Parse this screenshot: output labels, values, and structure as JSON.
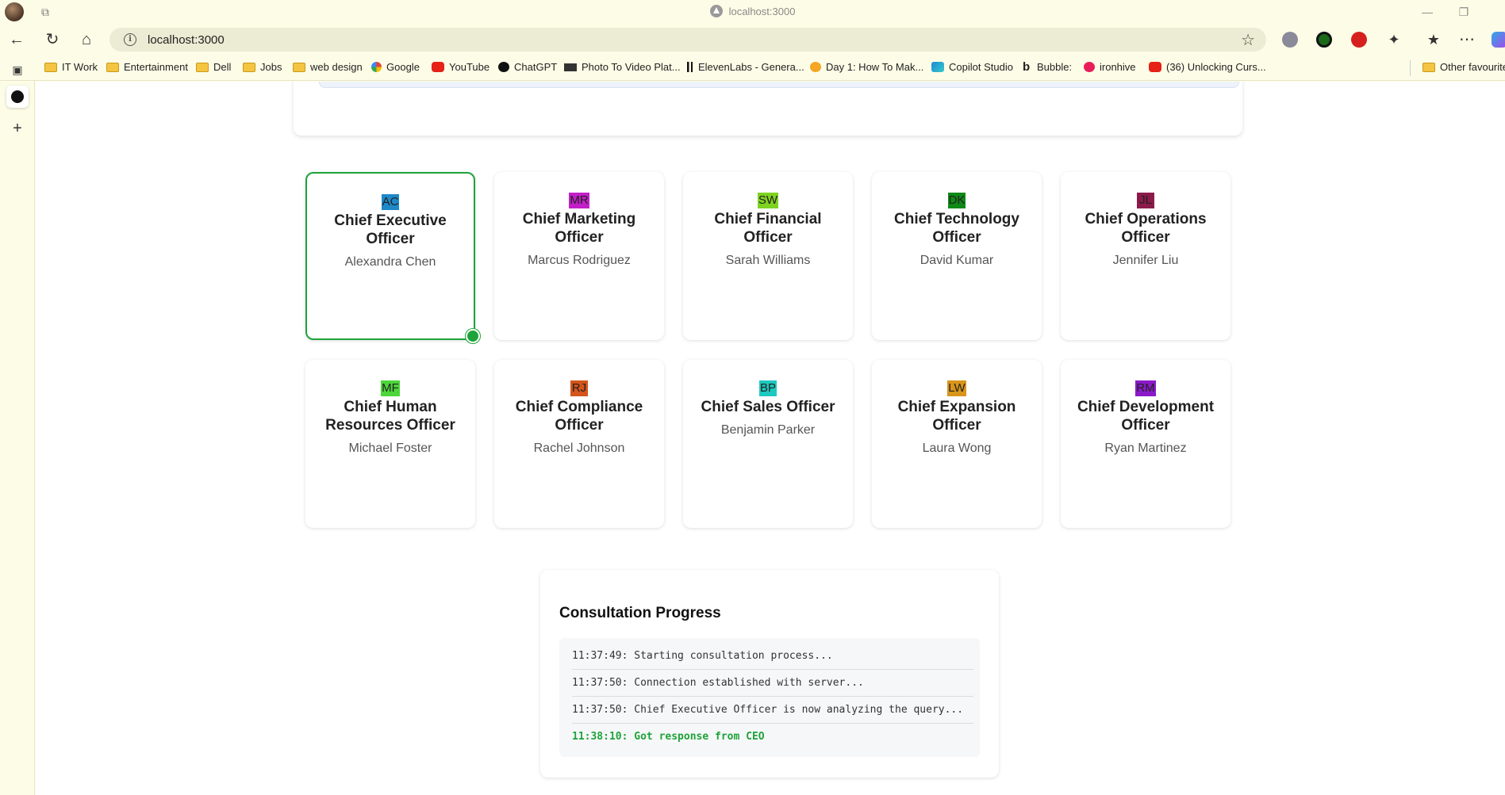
{
  "browser": {
    "tab_title": "localhost:3000",
    "url": "localhost:3000",
    "bookmarks": [
      {
        "label": "IT Work",
        "icon": "folder-icon"
      },
      {
        "label": "Entertainment",
        "icon": "folder-icon"
      },
      {
        "label": "Dell",
        "icon": "folder-icon"
      },
      {
        "label": "Jobs",
        "icon": "folder-icon"
      },
      {
        "label": "web design",
        "icon": "folder-icon"
      },
      {
        "label": "Google",
        "icon": "google-icon"
      },
      {
        "label": "YouTube",
        "icon": "youtube-icon"
      },
      {
        "label": "ChatGPT",
        "icon": "chatgpt-icon"
      },
      {
        "label": "Photo To Video Plat...",
        "icon": "photo-video-icon"
      },
      {
        "label": "ElevenLabs - Genera...",
        "icon": "elevenlabs-icon"
      },
      {
        "label": "Day 1: How To Mak...",
        "icon": "day1-icon"
      },
      {
        "label": "Copilot Studio",
        "icon": "copilot-icon"
      },
      {
        "label": "Bubble:",
        "icon": "bubble-icon"
      },
      {
        "label": "ironhive",
        "icon": "ironhive-icon"
      },
      {
        "label": "(36) Unlocking Curs...",
        "icon": "youtube-icon"
      }
    ],
    "other_favourites": "Other favourites"
  },
  "executives": [
    {
      "initials": "AC",
      "role": "Chief Executive Officer",
      "name": "Alexandra Chen",
      "color": "#1e88c8",
      "active": true
    },
    {
      "initials": "MR",
      "role": "Chief Marketing Officer",
      "name": "Marcus Rodriguez",
      "color": "#c21fc8",
      "active": false
    },
    {
      "initials": "SW",
      "role": "Chief Financial Officer",
      "name": "Sarah Williams",
      "color": "#7ed321",
      "active": false
    },
    {
      "initials": "DK",
      "role": "Chief Technology Officer",
      "name": "David Kumar",
      "color": "#0e8a16",
      "active": false
    },
    {
      "initials": "JL",
      "role": "Chief Operations Officer",
      "name": "Jennifer Liu",
      "color": "#8c1a4a",
      "active": false
    },
    {
      "initials": "MF",
      "role": "Chief Human Resources Officer",
      "name": "Michael Foster",
      "color": "#4cd63a",
      "active": false
    },
    {
      "initials": "RJ",
      "role": "Chief Compliance Officer",
      "name": "Rachel Johnson",
      "color": "#d4541a",
      "active": false
    },
    {
      "initials": "BP",
      "role": "Chief Sales Officer",
      "name": "Benjamin Parker",
      "color": "#1ec8c0",
      "active": false
    },
    {
      "initials": "LW",
      "role": "Chief Expansion Officer",
      "name": "Laura Wong",
      "color": "#d8951a",
      "active": false
    },
    {
      "initials": "RM",
      "role": "Chief Development Officer",
      "name": "Ryan Martinez",
      "color": "#8a1ac8",
      "active": false
    }
  ],
  "progress": {
    "heading": "Consultation Progress",
    "logs": [
      {
        "text": "11:37:49: Starting consultation process...",
        "status": "info"
      },
      {
        "text": "11:37:50: Connection established with server...",
        "status": "info"
      },
      {
        "text": "11:37:50: Chief Executive Officer is now analyzing the query...",
        "status": "info"
      },
      {
        "text": "11:38:10: Got response from CEO",
        "status": "success"
      }
    ]
  }
}
